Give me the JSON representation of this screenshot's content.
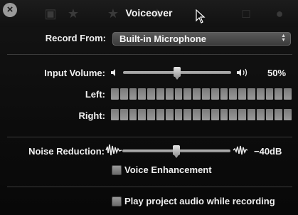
{
  "window": {
    "title": "Voiceover",
    "close_icon": "close-icon"
  },
  "record_from": {
    "label": "Record From:",
    "value": "Built-in Microphone"
  },
  "input_volume": {
    "label": "Input Volume:",
    "value": "50%",
    "level": 0.5
  },
  "meters": {
    "left_label": "Left:",
    "right_label": "Right:",
    "segments": 20
  },
  "noise_reduction": {
    "label": "Noise Reduction:",
    "value": "−40dB",
    "level": 0.5
  },
  "voice_enhancement": {
    "label": "Voice Enhancement",
    "checked": false
  },
  "play_project_audio": {
    "label": "Play project audio while recording",
    "checked": false
  }
}
